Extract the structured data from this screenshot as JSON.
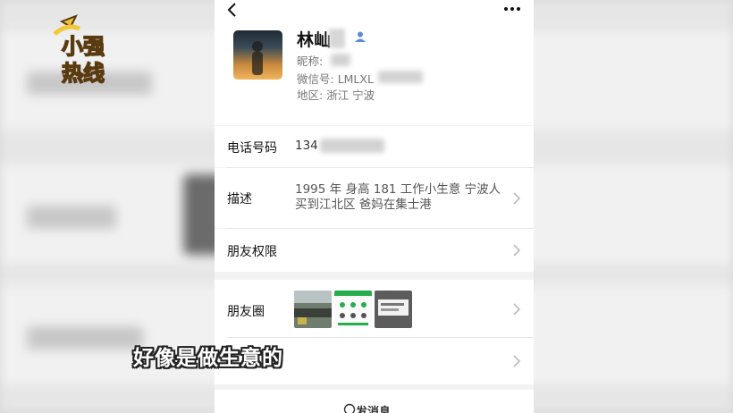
{
  "logo": {
    "text": "小强热线"
  },
  "profile": {
    "name": "林屾",
    "nickname_label": "昵称: ",
    "wechat_id_label": "微信号: ",
    "wechat_id_value": "LMLXL",
    "region_label": "地区: ",
    "region_value": "浙江  宁波"
  },
  "rows": {
    "phone_label": "电话号码",
    "phone_value": "134",
    "desc_label": "描述",
    "desc_line1": "1995 年 身高 181 工作小生意 宁波人",
    "desc_line2": "买到江北区 爸妈在集士港",
    "friend_perm_label": "朋友权限",
    "moments_label": "朋友圈"
  },
  "subtitle": "好像是做生意的",
  "send": {
    "label": "发消息"
  }
}
